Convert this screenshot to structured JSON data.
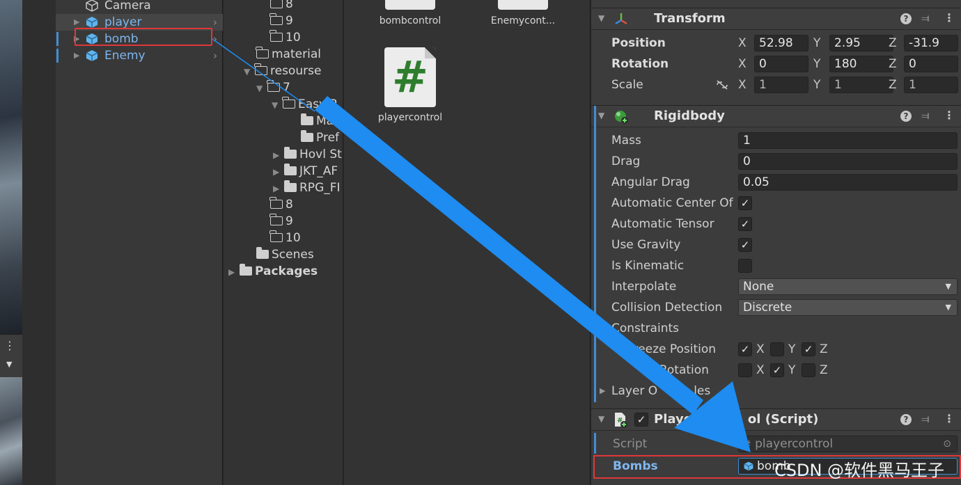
{
  "hierarchy": {
    "items": [
      {
        "label": "Camera",
        "icon": "camera-cube-icon"
      },
      {
        "label": "player",
        "icon": "prefab-cube-icon"
      },
      {
        "label": "bomb",
        "icon": "prefab-cube-icon"
      },
      {
        "label": "Enemy",
        "icon": "prefab-cube-icon"
      }
    ]
  },
  "project_tree": {
    "rows": [
      {
        "label": "8"
      },
      {
        "label": "9"
      },
      {
        "label": "10"
      },
      {
        "label": "material"
      },
      {
        "label": "resourse"
      },
      {
        "label": "7"
      },
      {
        "label": "Easy P"
      },
      {
        "label": "Mate"
      },
      {
        "label": "Pref"
      },
      {
        "label": "Hovl St"
      },
      {
        "label": "JKT_AF"
      },
      {
        "label": "RPG_FI"
      },
      {
        "label": "8"
      },
      {
        "label": "9"
      },
      {
        "label": "10"
      },
      {
        "label": "Scenes"
      },
      {
        "label": "Packages"
      }
    ]
  },
  "assets": {
    "items": [
      {
        "label": "bombcontrol"
      },
      {
        "label": "Enemycont..."
      },
      {
        "label": "playercontrol",
        "glyph": "#"
      }
    ]
  },
  "inspector": {
    "transform": {
      "title": "Transform",
      "position_label": "Position",
      "rotation_label": "Rotation",
      "scale_label": "Scale",
      "position": {
        "x": "52.98",
        "y": "2.95",
        "z": "-31.9"
      },
      "rotation": {
        "x": "0",
        "y": "180",
        "z": "0"
      },
      "scale": {
        "x": "1",
        "y": "1",
        "z": "1"
      },
      "axis": {
        "x": "X",
        "y": "Y",
        "z": "Z"
      }
    },
    "rigidbody": {
      "title": "Rigidbody",
      "mass_label": "Mass",
      "mass": "1",
      "drag_label": "Drag",
      "drag": "0",
      "angular_drag_label": "Angular Drag",
      "angular_drag": "0.05",
      "auto_center_label": "Automatic Center Of",
      "auto_tensor_label": "Automatic Tensor",
      "use_gravity_label": "Use Gravity",
      "is_kinematic_label": "Is Kinematic",
      "interpolate_label": "Interpolate",
      "interpolate": "None",
      "collision_label": "Collision Detection",
      "collision": "Discrete",
      "constraints_label": "Constraints",
      "freeze_position_label": "Freeze Position",
      "freeze_rotation_label": "e Rotation",
      "layer_overrides_label": "Layer O",
      "layer_overrides_tail": "les",
      "checked": "✓"
    },
    "script": {
      "title_a": "Playe",
      "title_b": "ol (Script)",
      "script_label": "Script",
      "script_value": "playercontrol",
      "bombs_label": "Bombs",
      "bombs_value": "bomb"
    },
    "help": "?"
  },
  "watermark": "CSDN @软件黑马王子",
  "colors": {
    "accent_blue": "#3f8fd6",
    "highlight_red": "#e0383b",
    "arrow_blue": "#1e8cf0"
  }
}
